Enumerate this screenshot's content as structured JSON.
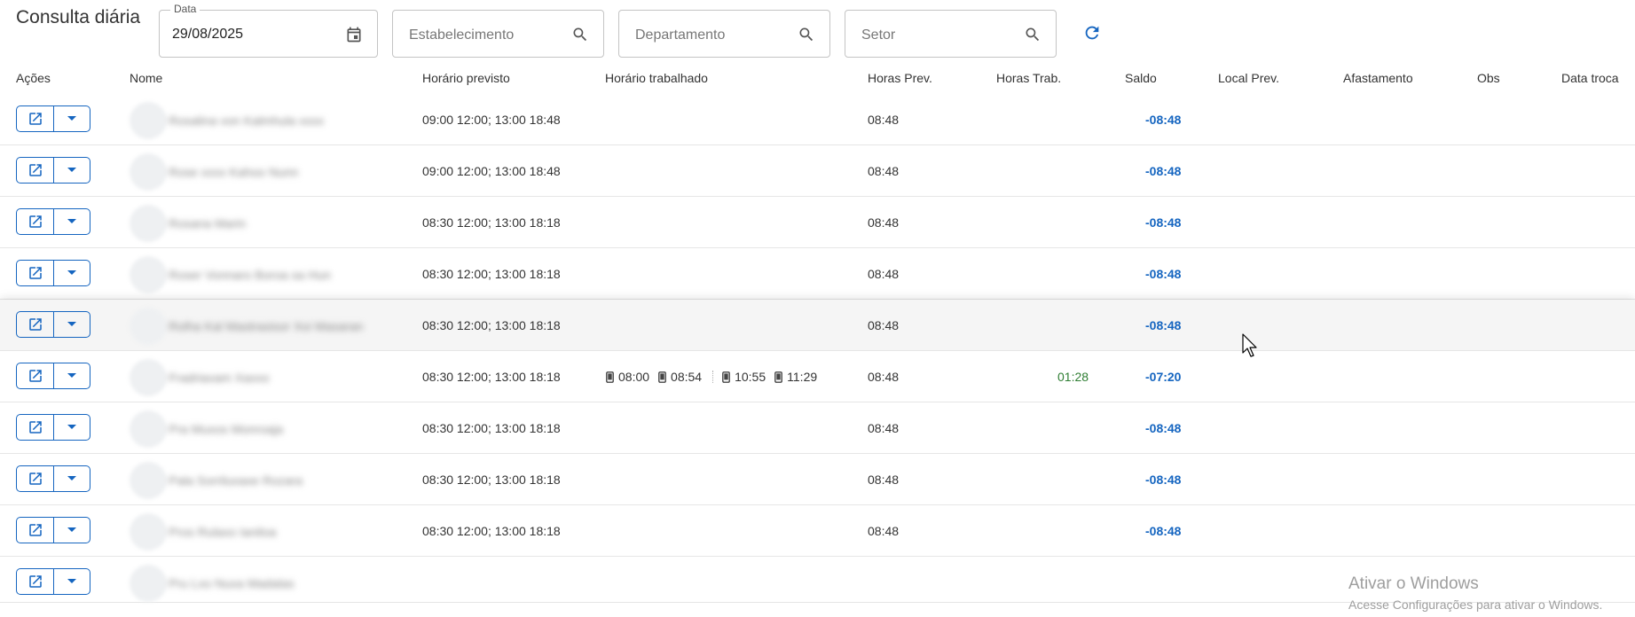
{
  "page": {
    "title": "Consulta diária"
  },
  "filters": {
    "date": {
      "legend": "Data",
      "value": "29/08/2025"
    },
    "estabelecimento": {
      "placeholder": "Estabelecimento"
    },
    "departamento": {
      "placeholder": "Departamento"
    },
    "setor": {
      "placeholder": "Setor"
    }
  },
  "columns": [
    "Ações",
    "Nome",
    "Horário previsto",
    "Horário trabalhado",
    "Horas Prev.",
    "Horas Trab.",
    "Saldo",
    "Local Prev.",
    "Afastamento",
    "Obs",
    "Data troca"
  ],
  "rows": [
    {
      "name": "Rosalina von Kalmhula xxxx",
      "previsto": "09:00 12:00; 13:00 18:48",
      "prev": "08:48",
      "trab": "",
      "saldo": "-08:48",
      "punches": []
    },
    {
      "name": "Rose xxxx Kahoo Nunn",
      "previsto": "09:00 12:00; 13:00 18:48",
      "prev": "08:48",
      "trab": "",
      "saldo": "-08:48",
      "punches": []
    },
    {
      "name": "Rosana Marin",
      "previsto": "08:30 12:00; 13:00 18:18",
      "prev": "08:48",
      "trab": "",
      "saldo": "-08:48",
      "punches": []
    },
    {
      "name": "Roser Vonnaro Boroa sa Hun",
      "previsto": "08:30 12:00; 13:00 18:18",
      "prev": "08:48",
      "trab": "",
      "saldo": "-08:48",
      "punches": []
    },
    {
      "name": "Rolha Kal Mastrasisor Xoi Masaran",
      "previsto": "08:30 12:00; 13:00 18:18",
      "prev": "08:48",
      "trab": "",
      "saldo": "-08:48",
      "punches": []
    },
    {
      "name": "Fradriaxam Xaxxo",
      "previsto": "08:30 12:00; 13:00 18:18",
      "prev": "08:48",
      "trab": "01:28",
      "saldo": "-07:20",
      "punches": [
        "08:00",
        "08:54",
        "10:55",
        "11:29"
      ]
    },
    {
      "name": "Pra Muxos Monroaja",
      "previsto": "08:30 12:00; 13:00 18:18",
      "prev": "08:48",
      "trab": "",
      "saldo": "-08:48",
      "punches": []
    },
    {
      "name": "Pala Sorriluxaxe Rozara",
      "previsto": "08:30 12:00; 13:00 18:18",
      "prev": "08:48",
      "trab": "",
      "saldo": "-08:48",
      "punches": []
    },
    {
      "name": "Pros Rulaxo Ianiloa",
      "previsto": "08:30 12:00; 13:00 18:18",
      "prev": "08:48",
      "trab": "",
      "saldo": "-08:48",
      "punches": []
    },
    {
      "name": "Pru Lxo Nuxa Madalas",
      "previsto": "",
      "prev": "",
      "trab": "",
      "saldo": "",
      "punches": []
    }
  ],
  "watermark": {
    "line1": "Ativar o Windows",
    "line2": "Acesse Configurações para ativar o Windows."
  },
  "colors": {
    "accent": "#1565c0",
    "positive": "#2e7d32"
  },
  "icons": [
    "calendar-icon",
    "search-icon",
    "refresh-icon",
    "open-in-new-icon",
    "chevron-down-icon",
    "phone-icon"
  ]
}
